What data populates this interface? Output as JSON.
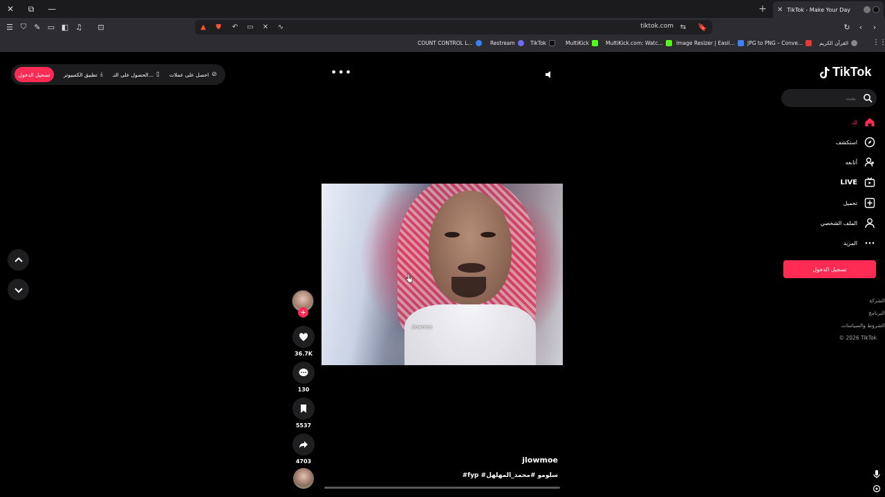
{
  "browser": {
    "tab_title": "TikTok - Make Your Day",
    "url": "tiktok.com",
    "bookmarks": [
      {
        "label": "COUNT CONTROL L...",
        "color": "#3b82f6"
      },
      {
        "label": "Restream",
        "color": "#6d6df5"
      },
      {
        "label": "TikTok",
        "color": "#111111"
      },
      {
        "label": "MultiKick",
        "color": "#53fc18"
      },
      {
        "label": "MultiKick.com: Watc...",
        "color": "#53fc18"
      },
      {
        "label": "Image Resizer | Easil...",
        "color": "#3b82f6"
      },
      {
        "label": "JPG to PNG – Conve...",
        "color": "#e53935"
      },
      {
        "label": "القرآن الكريم",
        "color": "#888888"
      }
    ]
  },
  "promo_bar": {
    "login": "تسجيل الدخول",
    "desktop_app": "تطبيق الكمبيوتر",
    "get_app": "الحصول على التـ...",
    "get_coins": "احصل على عملات"
  },
  "video": {
    "watermark": "jlowmoe",
    "username": "jlowmoe",
    "caption": "#fyp #سلومو #محمد_المهلهل"
  },
  "actions": {
    "likes": "36.7K",
    "comments": "130",
    "saves": "5537",
    "shares": "4703"
  },
  "sidebar": {
    "logo": "TikTok",
    "search_placeholder": "بحث",
    "items": [
      {
        "label": "لك",
        "icon": "home-icon",
        "active": true
      },
      {
        "label": "استكشف",
        "icon": "compass-icon"
      },
      {
        "label": "أتابعه",
        "icon": "following-icon"
      },
      {
        "label": "LIVE",
        "icon": "live-icon"
      },
      {
        "label": "تحميل",
        "icon": "upload-icon"
      },
      {
        "label": "الملف الشخصي",
        "icon": "profile-icon"
      },
      {
        "label": "المزيد",
        "icon": "more-icon"
      }
    ],
    "login_button": "تسجيل الدخول",
    "footer": [
      "الشركة",
      "البرنامج",
      "الشروط والسياسات",
      "© 2026 TikTok"
    ]
  },
  "colors": {
    "accent": "#fe2c55",
    "background": "#000000"
  }
}
